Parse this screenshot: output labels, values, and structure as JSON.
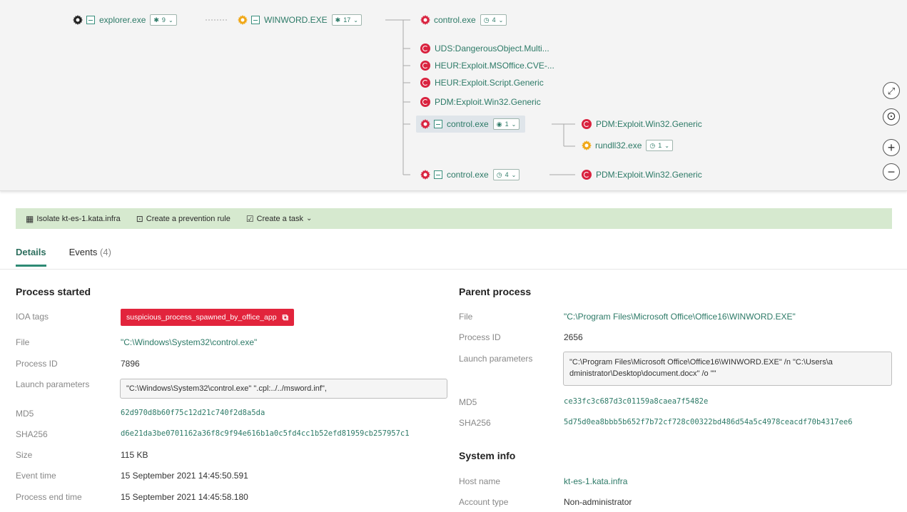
{
  "tree": {
    "root": {
      "name": "explorer.exe",
      "badge_count": "9"
    },
    "parent": {
      "name": "WINWORD.EXE",
      "badge_count": "17"
    },
    "children": [
      {
        "type": "process",
        "name": "control.exe",
        "badge_count": "4"
      },
      {
        "type": "threat",
        "name": "UDS:DangerousObject.Multi..."
      },
      {
        "type": "threat",
        "name": "HEUR:Exploit.MSOffice.CVE-..."
      },
      {
        "type": "threat",
        "name": "HEUR:Exploit.Script.Generic"
      },
      {
        "type": "threat",
        "name": "PDM:Exploit.Win32.Generic"
      },
      {
        "type": "process",
        "name": "control.exe",
        "badge_count": "1",
        "selected": true
      },
      {
        "type": "process",
        "name": "control.exe",
        "badge_count": "4"
      }
    ],
    "selected_children": [
      {
        "type": "threat",
        "name": "PDM:Exploit.Win32.Generic"
      },
      {
        "type": "process",
        "name": "rundll32.exe",
        "badge_count": "1"
      }
    ],
    "last_child_threat": "PDM:Exploit.Win32.Generic"
  },
  "zoom_controls": {
    "fit": "⤢",
    "center": "⊙",
    "zoom_in": "+",
    "zoom_out": "−"
  },
  "toolbar": {
    "isolate": "Isolate kt-es-1.kata.infra",
    "prevention": "Create a prevention rule",
    "task": "Create a task"
  },
  "tabs": {
    "details": "Details",
    "events": "Events",
    "events_count": "(4)"
  },
  "process_started": {
    "title": "Process started",
    "ioa_label": "IOA tags",
    "ioa_value": "suspicious_process_spawned_by_office_app",
    "file_label": "File",
    "file_value": "\"C:\\Windows\\System32\\control.exe\"",
    "pid_label": "Process ID",
    "pid_value": "7896",
    "params_label": "Launch parameters",
    "params_value": "\"C:\\Windows\\System32\\control.exe\" \".cpl:../../msword.inf\",",
    "md5_label": "MD5",
    "md5_value": "62d970d8b60f75c12d21c740f2d8a5da",
    "sha256_label": "SHA256",
    "sha256_value": "d6e21da3be0701162a36f8c9f94e616b1a0c5fd4cc1b52efd81959cb257957c1",
    "size_label": "Size",
    "size_value": "115 KB",
    "event_time_label": "Event time",
    "event_time_value": "15 September 2021 14:45:50.591",
    "end_time_label": "Process end time",
    "end_time_value": "15 September 2021 14:45:58.180"
  },
  "parent_process": {
    "title": "Parent process",
    "file_label": "File",
    "file_value": "\"C:\\Program Files\\Microsoft Office\\Office16\\WINWORD.EXE\"",
    "pid_label": "Process ID",
    "pid_value": "2656",
    "params_label": "Launch parameters",
    "params_line1": "\"C:\\Program Files\\Microsoft Office\\Office16\\WINWORD.EXE\" /n \"C:\\Users\\a",
    "params_line2": "dministrator\\Desktop\\document.docx\" /o \"\"",
    "md5_label": "MD5",
    "md5_value": "ce33fc3c687d3c01159a8caea7f5482e",
    "sha256_label": "SHA256",
    "sha256_value": "5d75d0ea8bbb5b652f7b72cf728c00322bd486d54a5c4978ceacdf70b4317ee6"
  },
  "system_info": {
    "title": "System info",
    "host_label": "Host name",
    "host_value": "kt-es-1.kata.infra",
    "account_label": "Account type",
    "account_value": "Non-administrator"
  }
}
